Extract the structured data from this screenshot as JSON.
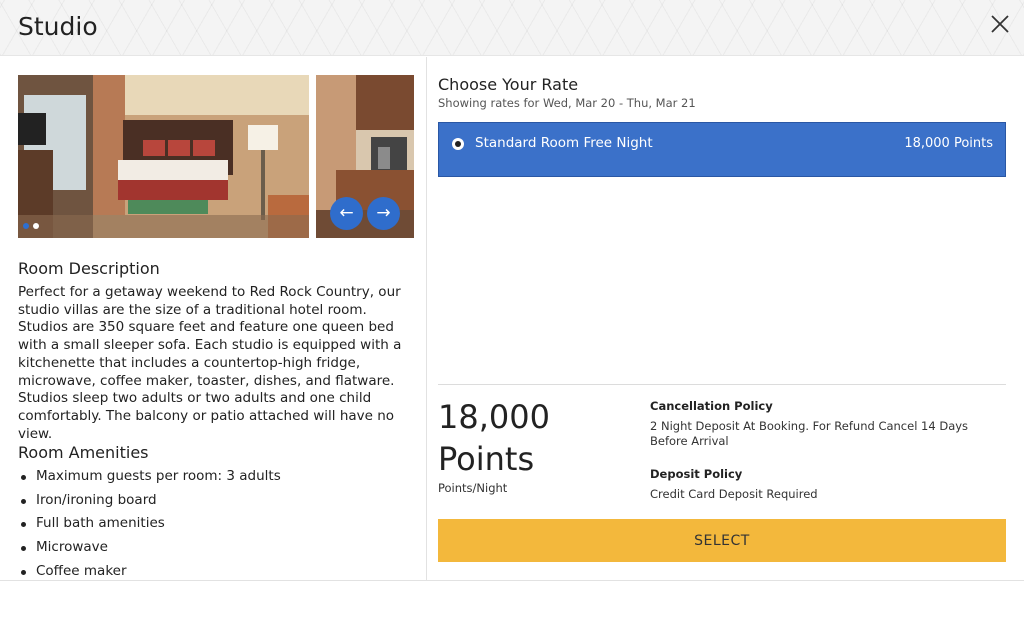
{
  "modal": {
    "title": "Studio",
    "close_icon": "close-icon"
  },
  "gallery": {
    "prev_arrow": "←",
    "next_arrow": "→",
    "slide_count": 2,
    "active_slide": 1
  },
  "room_description": {
    "heading": "Room Description",
    "text": "Perfect for a getaway weekend to Red Rock Country, our studio villas are the size of a traditional hotel room. Studios are 350 square feet and feature one queen bed with a small sleeper sofa. Each studio is equipped with a kitchenette that includes a countertop-high fridge, microwave, coffee maker, toaster, dishes, and flatware. Studios sleep two adults or two adults and one child comfortably. The balcony or patio attached will have no view."
  },
  "room_amenities": {
    "heading": "Room Amenities",
    "items": [
      "Maximum guests per room: 3 adults",
      "Iron/ironing board",
      "Full bath amenities",
      "Microwave",
      "Coffee maker"
    ]
  },
  "rates": {
    "heading": "Choose Your Rate",
    "dates": "Showing rates for Wed, Mar 20 - Thu, Mar 21",
    "options": [
      {
        "name": "Standard Room Free Night",
        "price": "18,000 Points",
        "selected": true
      }
    ]
  },
  "price": {
    "amount_line1": "18,000",
    "amount_line2": "Points",
    "unit": "Points/Night"
  },
  "policies": {
    "cancellation_heading": "Cancellation Policy",
    "cancellation_text": "2 Night Deposit At Booking. For Refund Cancel 14 Days Before Arrival",
    "deposit_heading": "Deposit Policy",
    "deposit_text": "Credit Card Deposit Required"
  },
  "select_button": {
    "label": "SELECT"
  },
  "colors": {
    "rate_selected_bg": "#3b71c9",
    "select_button_bg": "#f3b83c",
    "nav_button_bg": "#2f6dcc"
  }
}
